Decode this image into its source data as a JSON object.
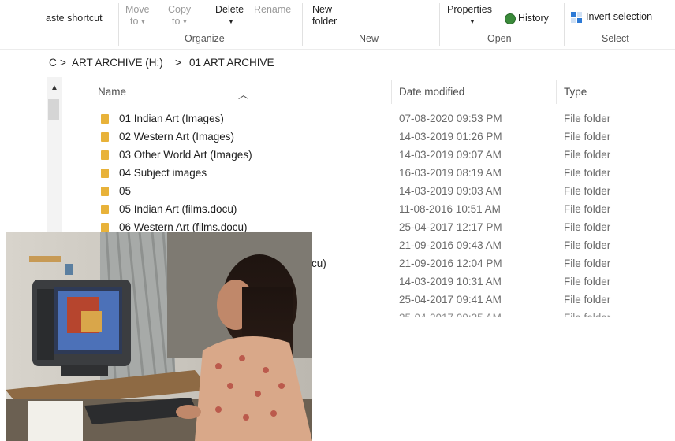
{
  "ribbon": {
    "paste_shortcut": "aste shortcut",
    "move_to": [
      "Move",
      "to"
    ],
    "copy_to": [
      "Copy",
      "to"
    ],
    "delete": "Delete",
    "rename": "Rename",
    "new_folder": [
      "New",
      "folder"
    ],
    "properties": "Properties",
    "history": "History",
    "invert_selection": "Invert selection",
    "groups": {
      "organize": "Organize",
      "new": "New",
      "open": "Open",
      "select": "Select"
    }
  },
  "address": {
    "prefix": "C",
    "drive": "ART ARCHIVE (H:)",
    "folder": "01 ART ARCHIVE"
  },
  "columns": {
    "name": "Name",
    "date": "Date modified",
    "type": "Type"
  },
  "files": [
    {
      "name": "01 Indian Art (Images)",
      "date": "07-08-2020 09:53 PM",
      "type": "File folder"
    },
    {
      "name": "02 Western Art (Images)",
      "date": "14-03-2019 01:26 PM",
      "type": "File folder"
    },
    {
      "name": "03 Other World Art (Images)",
      "date": "14-03-2019 09:07 AM",
      "type": "File folder"
    },
    {
      "name": "04 Subject images",
      "date": "16-03-2019 08:19 AM",
      "type": "File folder"
    },
    {
      "name": "05",
      "date": "14-03-2019 09:03 AM",
      "type": "File folder"
    },
    {
      "name": "05 Indian Art (films.docu)",
      "date": "11-08-2016 10:51 AM",
      "type": "File folder"
    },
    {
      "name": "06 Western Art (films.docu)",
      "date": "25-04-2017 12:17 PM",
      "type": "File folder"
    },
    {
      "name": "",
      "date": "21-09-2016 09:43 AM",
      "type": "File folder"
    },
    {
      "name": "cu)",
      "date": "21-09-2016 12:04 PM",
      "type": "File folder"
    },
    {
      "name": "",
      "date": "14-03-2019 10:31 AM",
      "type": "File folder"
    },
    {
      "name": "",
      "date": "25-04-2017 09:41 AM",
      "type": "File folder"
    }
  ]
}
